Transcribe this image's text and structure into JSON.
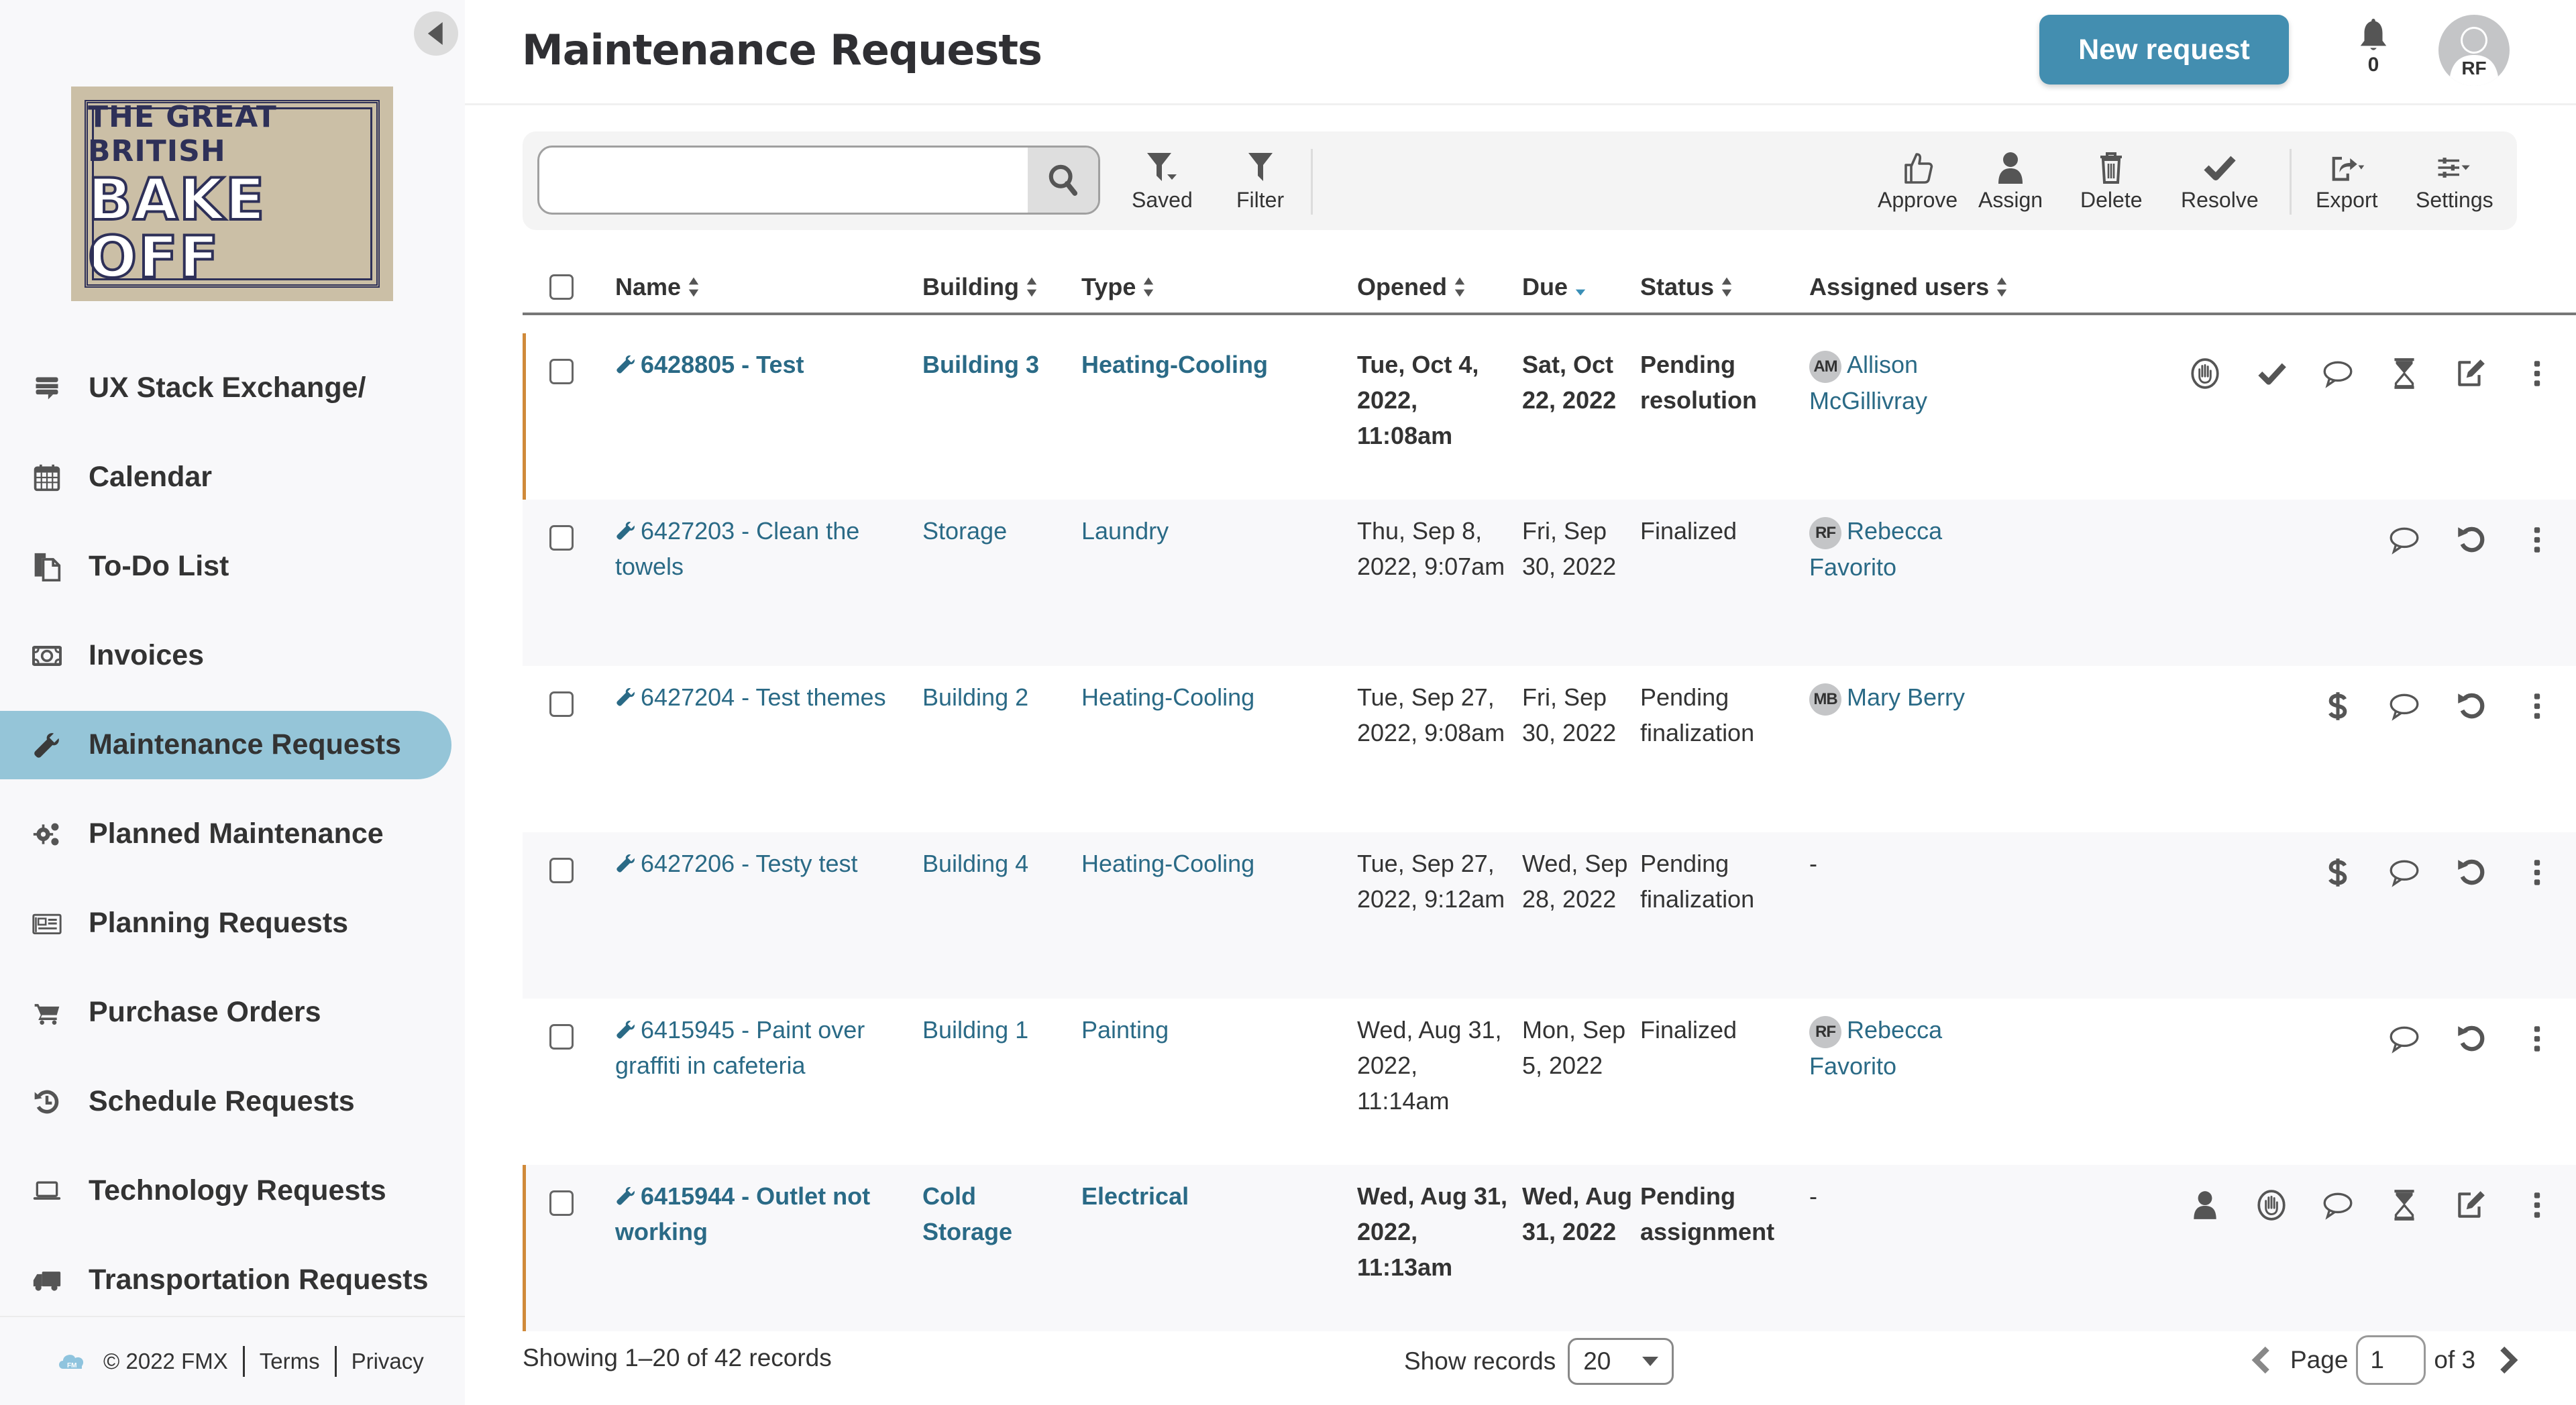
{
  "app": {
    "page_title": "Maintenance Requests",
    "logo": {
      "line1": "THE GREAT BRITISH",
      "line2": "BAKE OFF",
      "icon": "bake-off-logo"
    }
  },
  "sidebar": {
    "collapse_icon": "caret-left-icon",
    "items": [
      {
        "label": "UX Stack Exchange/",
        "icon": "stack-exchange-icon",
        "active": false
      },
      {
        "label": "Calendar",
        "icon": "calendar-icon",
        "active": false
      },
      {
        "label": "To-Do List",
        "icon": "copy-icon",
        "active": false
      },
      {
        "label": "Invoices",
        "icon": "money-bill-icon",
        "active": false
      },
      {
        "label": "Maintenance Requests",
        "icon": "wrench-icon",
        "active": true
      },
      {
        "label": "Planned Maintenance",
        "icon": "cogs-icon",
        "active": false
      },
      {
        "label": "Planning Requests",
        "icon": "newspaper-icon",
        "active": false
      },
      {
        "label": "Purchase Orders",
        "icon": "cart-icon",
        "active": false
      },
      {
        "label": "Schedule Requests",
        "icon": "history-icon",
        "active": false
      },
      {
        "label": "Technology Requests",
        "icon": "laptop-icon",
        "active": false
      },
      {
        "label": "Transportation Requests",
        "icon": "truck-icon",
        "active": false
      }
    ],
    "footer": {
      "copyright": "© 2022 FMX",
      "terms": "Terms",
      "privacy": "Privacy"
    }
  },
  "header": {
    "new_request_label": "New request",
    "notifications_count": "0",
    "user_initials": "RF"
  },
  "toolbar": {
    "search": {
      "value": "",
      "placeholder": ""
    },
    "left_tools": [
      {
        "label": "Saved",
        "icon": "saved-filter-icon"
      },
      {
        "label": "Filter",
        "icon": "filter-icon"
      }
    ],
    "right_tools": [
      {
        "label": "Approve",
        "icon": "thumbs-up-icon"
      },
      {
        "label": "Assign",
        "icon": "user-icon"
      },
      {
        "label": "Delete",
        "icon": "trash-icon"
      },
      {
        "label": "Resolve",
        "icon": "check-icon"
      },
      {
        "label": "Export",
        "icon": "share-icon"
      },
      {
        "label": "Settings",
        "icon": "sliders-icon"
      }
    ]
  },
  "table": {
    "columns": [
      {
        "label": "Name",
        "sort": "both"
      },
      {
        "label": "Building",
        "sort": "both"
      },
      {
        "label": "Type",
        "sort": "both"
      },
      {
        "label": "Opened",
        "sort": "both"
      },
      {
        "label": "Due",
        "sort": "desc-active"
      },
      {
        "label": "Status",
        "sort": "both"
      },
      {
        "label": "Assigned users",
        "sort": "both"
      }
    ],
    "accent_flag_color": "#d08a3a",
    "link_color": "#2a6a86",
    "rows": [
      {
        "name": "6428805 - Test",
        "building": "Building 3",
        "type": "Heating-Cooling",
        "opened": "Tue, Oct 4, 2022, 11:08am",
        "due": "Sat, Oct 22, 2022",
        "status": "Pending resolution",
        "user_initials": "AM",
        "user_name": "Allison McGillivray",
        "bold": true,
        "flagged": true,
        "actions": [
          "hold-icon",
          "check-icon",
          "comment-icon",
          "hourglass-icon",
          "edit-icon",
          "more-icon"
        ]
      },
      {
        "name": "6427203 - Clean the towels",
        "building": "Storage",
        "type": "Laundry",
        "opened": "Thu, Sep 8, 2022, 9:07am",
        "due": "Fri, Sep 30, 2022",
        "status": "Finalized",
        "user_initials": "RF",
        "user_name": "Rebecca Favorito",
        "bold": false,
        "flagged": false,
        "actions": [
          "comment-icon",
          "undo-icon",
          "more-icon"
        ]
      },
      {
        "name": "6427204 - Test themes",
        "building": "Building 2",
        "type": "Heating-Cooling",
        "opened": "Tue, Sep 27, 2022, 9:08am",
        "due": "Fri, Sep 30, 2022",
        "status": "Pending finalization",
        "user_initials": "MB",
        "user_name": "Mary Berry",
        "bold": false,
        "flagged": false,
        "actions": [
          "dollar-icon",
          "comment-icon",
          "undo-icon",
          "more-icon"
        ]
      },
      {
        "name": "6427206 - Testy test",
        "building": "Building 4",
        "type": "Heating-Cooling",
        "opened": "Tue, Sep 27, 2022, 9:12am",
        "due": "Wed, Sep 28, 2022",
        "status": "Pending finalization",
        "user_initials": "",
        "user_name": "-",
        "bold": false,
        "flagged": false,
        "actions": [
          "dollar-icon",
          "comment-icon",
          "undo-icon",
          "more-icon"
        ]
      },
      {
        "name": "6415945 - Paint over graffiti in cafeteria",
        "building": "Building 1",
        "type": "Painting",
        "opened": "Wed, Aug 31, 2022, 11:14am",
        "due": "Mon, Sep 5, 2022",
        "status": "Finalized",
        "user_initials": "RF",
        "user_name": "Rebecca Favorito",
        "bold": false,
        "flagged": false,
        "actions": [
          "comment-icon",
          "undo-icon",
          "more-icon"
        ]
      },
      {
        "name": "6415944 - Outlet not working",
        "building": "Cold Storage",
        "type": "Electrical",
        "opened": "Wed, Aug 31, 2022, 11:13am",
        "due": "Wed, Aug 31, 2022",
        "status": "Pending assignment",
        "user_initials": "",
        "user_name": "-",
        "bold": true,
        "flagged": true,
        "actions": [
          "user-icon",
          "hold-icon",
          "comment-icon",
          "hourglass-icon",
          "edit-icon",
          "more-icon"
        ]
      }
    ]
  },
  "footer": {
    "showing": "Showing 1–20 of 42 records",
    "show_records_label": "Show records",
    "page_size": "20",
    "page_label": "Page",
    "page_value": "1",
    "page_of": "of 3"
  },
  "colors": {
    "primary": "#438eb0",
    "active_nav": "#95c5d8",
    "sidebar_bg": "#f8f8fa"
  }
}
